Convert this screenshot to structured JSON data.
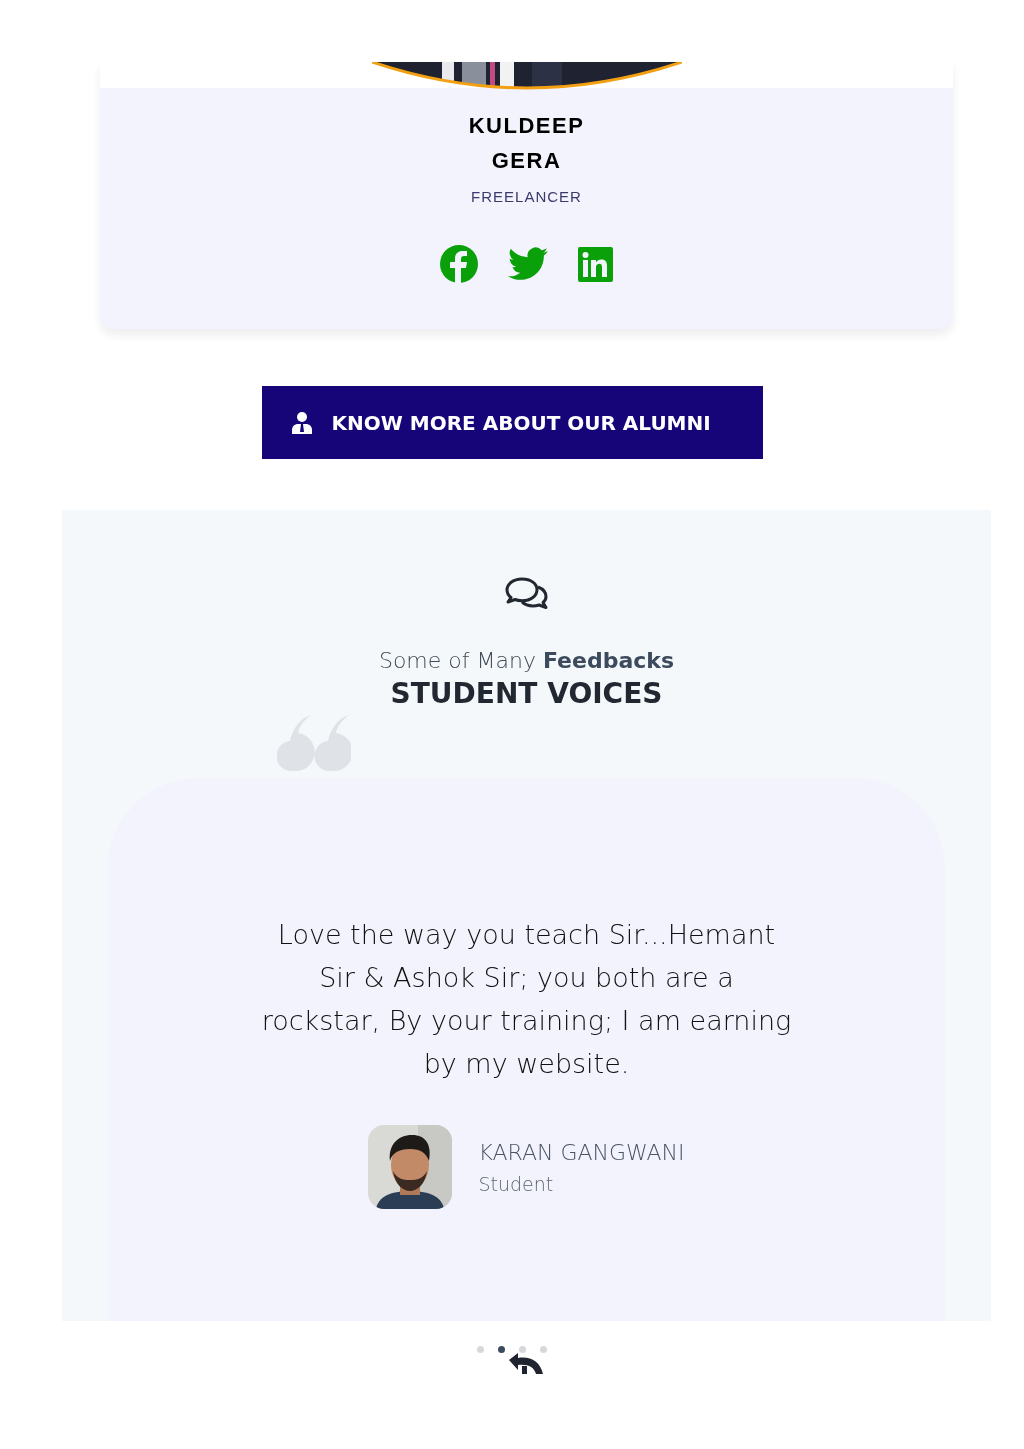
{
  "profile_card": {
    "name": "KULDEEP GERA",
    "role": "FREELANCER",
    "socials": [
      {
        "kind": "facebook"
      },
      {
        "kind": "twitter"
      },
      {
        "kind": "linkedin"
      }
    ]
  },
  "alumni_button": {
    "label": "KNOW MORE ABOUT OUR ALUMNI"
  },
  "testimonials": {
    "subtitle": "Some of Many **Feedbacks**",
    "title": "STUDENT VOICES",
    "quote": "Love the way you teach Sir...Hemant Sir & Ashok Sir; you both are a rockstar, By your training; I am earning by my website.",
    "author": "KARAN GANGWANI",
    "author_role": "Student",
    "dots": [
      {
        "selected": false
      },
      {
        "selected": true
      },
      {
        "selected": false
      },
      {
        "selected": false
      }
    ]
  }
}
